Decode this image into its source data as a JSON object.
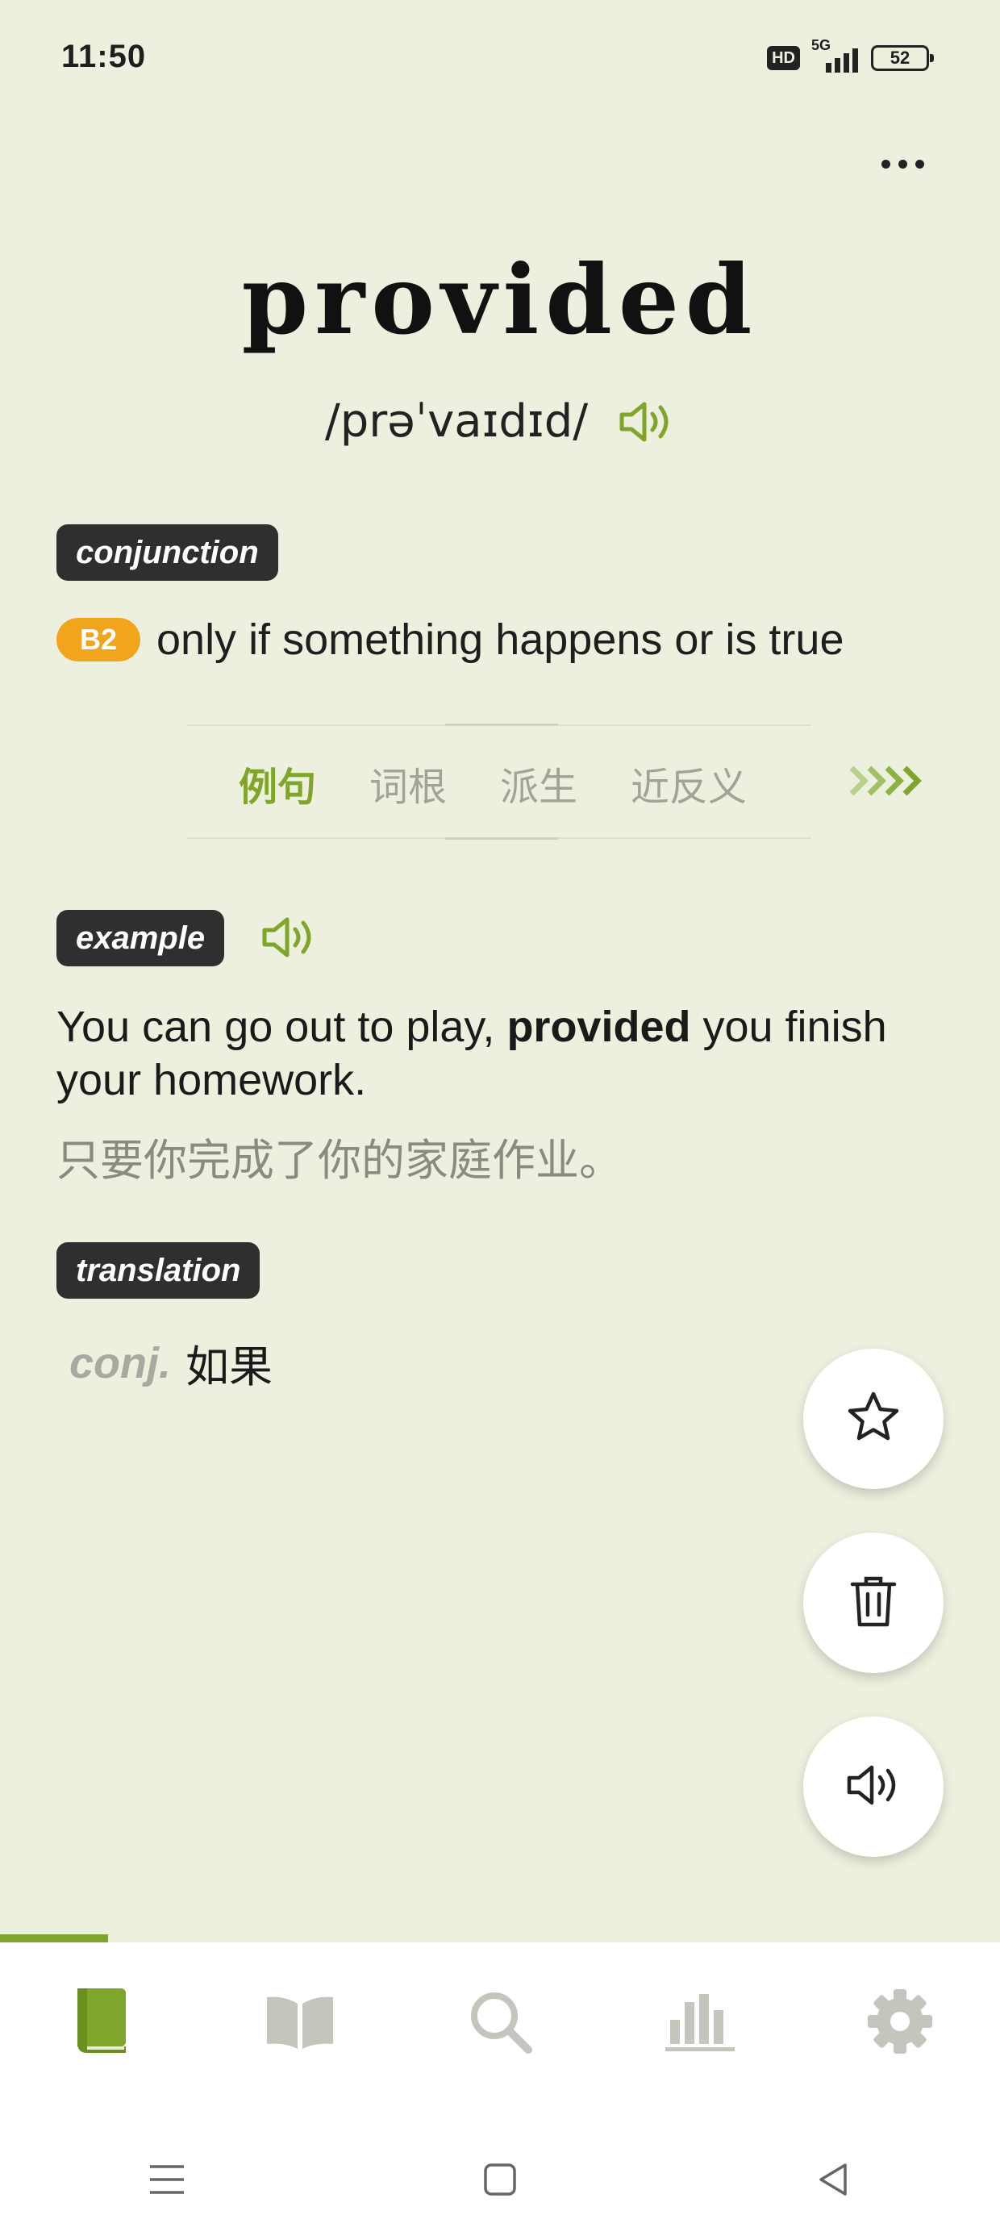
{
  "status_bar": {
    "time": "11:50",
    "hd": "HD",
    "network": "5G",
    "battery": "52"
  },
  "word": {
    "headword": "provided",
    "phonetic": "/prəˈvaɪdɪd/"
  },
  "definition": {
    "part_of_speech": "conjunction",
    "level": "B2",
    "text": "only if something happens or is true"
  },
  "tabs": [
    {
      "label": "例句",
      "active": true
    },
    {
      "label": "词根",
      "active": false
    },
    {
      "label": "派生",
      "active": false
    },
    {
      "label": "近反义",
      "active": false
    }
  ],
  "example": {
    "tag": "example",
    "sentence_before": "You can go out to play, ",
    "sentence_bold": "provided",
    "sentence_after": " you finish your homework.",
    "translation": "只要你完成了你的家庭作业。"
  },
  "translation": {
    "tag": "translation",
    "pos_abbr": "conj.",
    "meaning": "如果"
  },
  "fabs": [
    "star-icon",
    "trash-icon",
    "speaker-icon"
  ],
  "progress": 0.108,
  "bottom_nav": [
    "wordbook-icon",
    "open-book-icon",
    "search-icon",
    "stats-icon",
    "gear-icon"
  ],
  "system_nav": [
    "menu-icon",
    "home-icon",
    "back-icon"
  ],
  "colors": {
    "background": "#eef0df",
    "accent_green": "#7fa52b",
    "level_orange": "#f1a51d",
    "tag_dark": "#2f2f2f"
  }
}
